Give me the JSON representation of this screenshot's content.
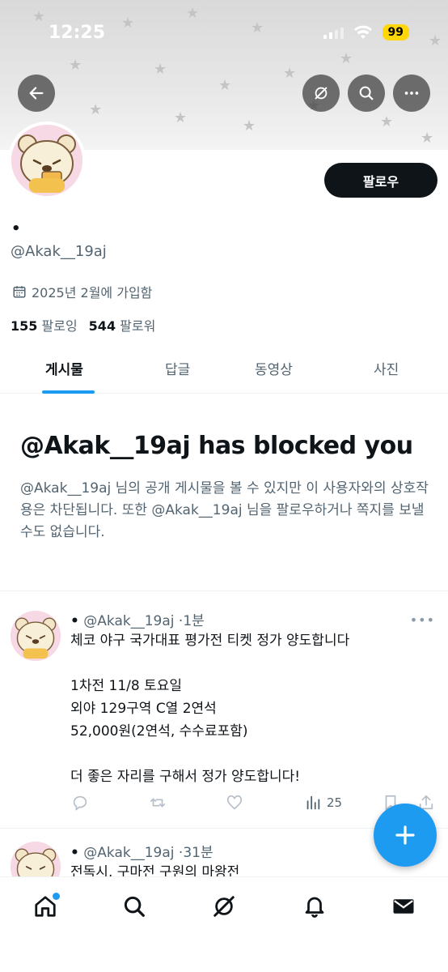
{
  "status_bar": {
    "time": "12:25",
    "battery": "99"
  },
  "profile": {
    "display_name": "•",
    "handle": "@Akak__19aj",
    "joined": "2025년 2월에 가입함",
    "following_count": "155",
    "following_label": "팔로잉",
    "followers_count": "544",
    "followers_label": "팔로워",
    "follow_button": "팔로우"
  },
  "tabs": [
    {
      "label": "게시물",
      "active": true
    },
    {
      "label": "답글",
      "active": false
    },
    {
      "label": "동영상",
      "active": false
    },
    {
      "label": "사진",
      "active": false
    }
  ],
  "blocked": {
    "title": "@Akak__19aj has blocked you",
    "description": "@Akak__19aj 님의 공개 게시물을 볼 수 있지만 이 사용자와의 상호작용은 차단됩니다. 또한 @Akak__19aj 님을 팔로우하거나 쪽지를 보낼 수도 없습니다."
  },
  "posts": [
    {
      "name": "•",
      "handle": "@Akak__19aj",
      "time": "1분",
      "body": "체코 야구 국가대표 평가전 티켓 정가 양도합니다\n\n1차전 11/8 토요일\n외야 129구역 C열 2연석\n52,000원(2연석, 수수료포함)\n\n더 좋은 자리를 구해서 정가 양도합니다!",
      "views": "25"
    },
    {
      "name": "•",
      "handle": "@Akak__19aj",
      "time": "31분",
      "body": "전독시, 구마전 구원의 마왕전"
    }
  ],
  "colors": {
    "accent": "#1d9bf0",
    "text": "#0f1419",
    "secondary": "#536471"
  },
  "icons": [
    "back-arrow-icon",
    "grok-icon",
    "search-icon",
    "more-icon",
    "calendar-icon",
    "reply-icon",
    "repost-icon",
    "like-icon",
    "views-icon",
    "bookmark-icon",
    "share-icon",
    "plus-icon",
    "home-icon",
    "bell-icon",
    "mail-icon"
  ]
}
